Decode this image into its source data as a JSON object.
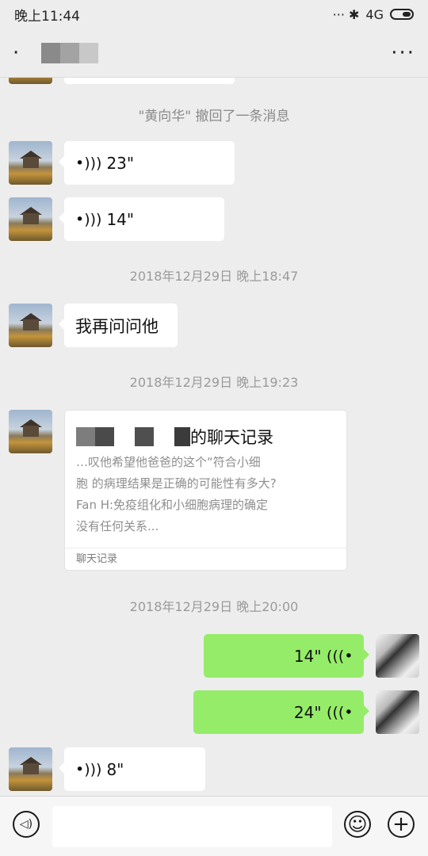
{
  "status_bar": {
    "time": "晚上11:44",
    "right_text": "··· ✱ ",
    "network": "4G"
  },
  "title_bar": {
    "more_label": "···"
  },
  "chat": {
    "recall_notice": "\"黄向华\" 撤回了一条消息",
    "voice_1": "23\"",
    "voice_2": "14\"",
    "time_1": "2018年12月29日 晚上18:47",
    "text_msg": "我再问问他",
    "time_2": "2018年12月29日 晚上19:23",
    "card": {
      "title_suffix": "的聊天记录",
      "line_1": "       …叹他希望他爸爸的这个“符合小细",
      "line_2": "胞  的病理结果是正确的可能性有多大?",
      "line_3": "Fan H:免疫组化和小细胞病理的确定",
      "line_4": "没有任何关系...",
      "footer": "聊天记录"
    },
    "time_3": "2018年12月29日 晚上20:00",
    "voice_r1": "14\"",
    "voice_r2": "24\"",
    "voice_3": "8\""
  },
  "input_bar": {
    "voice_button": "◁)",
    "emoji_button": "☺",
    "plus_button": "+"
  }
}
